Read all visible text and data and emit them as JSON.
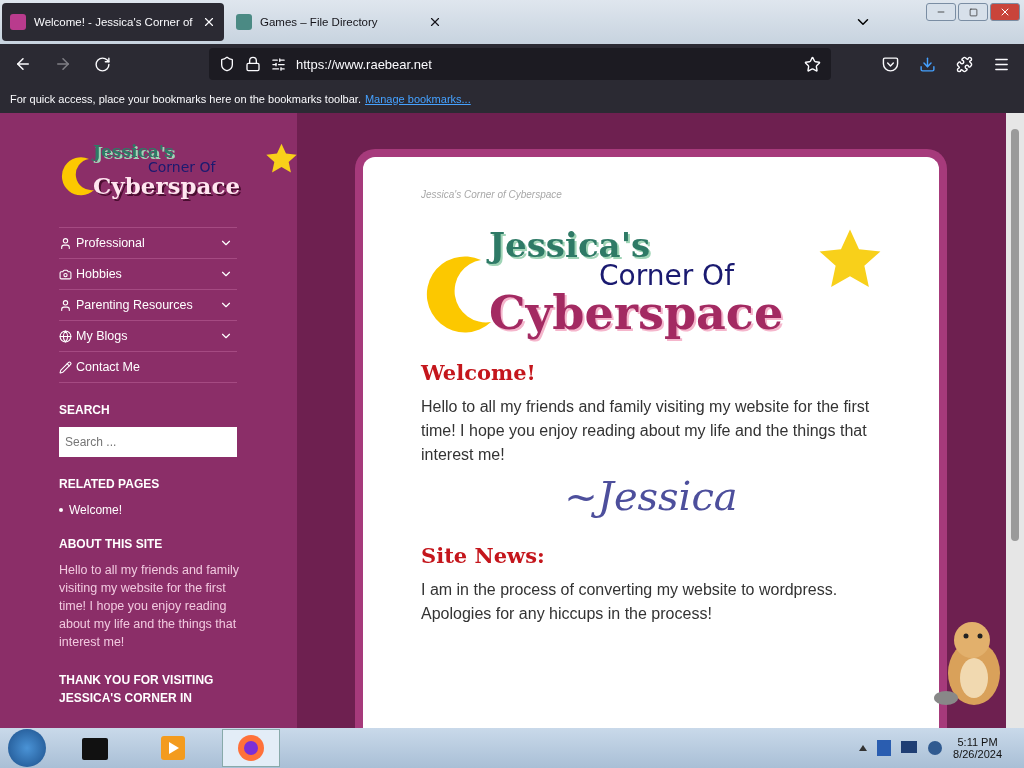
{
  "tabs": [
    {
      "title": "Welcome! - Jessica's Corner of",
      "selected": true
    },
    {
      "title": "Games – File Directory",
      "selected": false
    }
  ],
  "address": {
    "url": "https://www.raebear.net"
  },
  "bookmarks_bar": {
    "message": "For quick access, place your bookmarks here on the bookmarks toolbar.",
    "link": "Manage bookmarks..."
  },
  "sidebar": {
    "logo": {
      "line1": "Jessica's",
      "line2": "Corner Of",
      "line3": "Cyberspace"
    },
    "menu": [
      {
        "label": "Professional",
        "has_submenu": true
      },
      {
        "label": "Hobbies",
        "has_submenu": true
      },
      {
        "label": "Parenting Resources",
        "has_submenu": true
      },
      {
        "label": "My Blogs",
        "has_submenu": true
      },
      {
        "label": "Contact Me",
        "has_submenu": false
      }
    ],
    "search": {
      "heading": "SEARCH",
      "placeholder": "Search ..."
    },
    "related": {
      "heading": "RELATED PAGES",
      "items": [
        "Welcome!"
      ]
    },
    "about": {
      "heading": "ABOUT THIS SITE",
      "text": "Hello to all my friends and family visiting my website for the first time! I hope you enjoy reading about my life and the things that interest me!"
    },
    "thanks": {
      "heading": "THANK YOU FOR VISITING JESSICA'S CORNER IN"
    }
  },
  "main": {
    "site_title": "Jessica's Corner of Cyberspace",
    "logo": {
      "line1": "Jessica's",
      "line2": "Corner Of",
      "line3": "Cyberspace"
    },
    "sections": [
      {
        "heading": "Welcome!",
        "text": "Hello to all my friends and family visiting my website for the first time! I hope you enjoy reading about my life and the things that interest me!",
        "signature": "~Jessica"
      },
      {
        "heading": "Site News:",
        "text": "I am in the process of converting my website to wordpress. Apologies for any hiccups in the process!"
      }
    ]
  },
  "taskbar": {
    "time": "5:11 PM",
    "date": "8/26/2024"
  }
}
